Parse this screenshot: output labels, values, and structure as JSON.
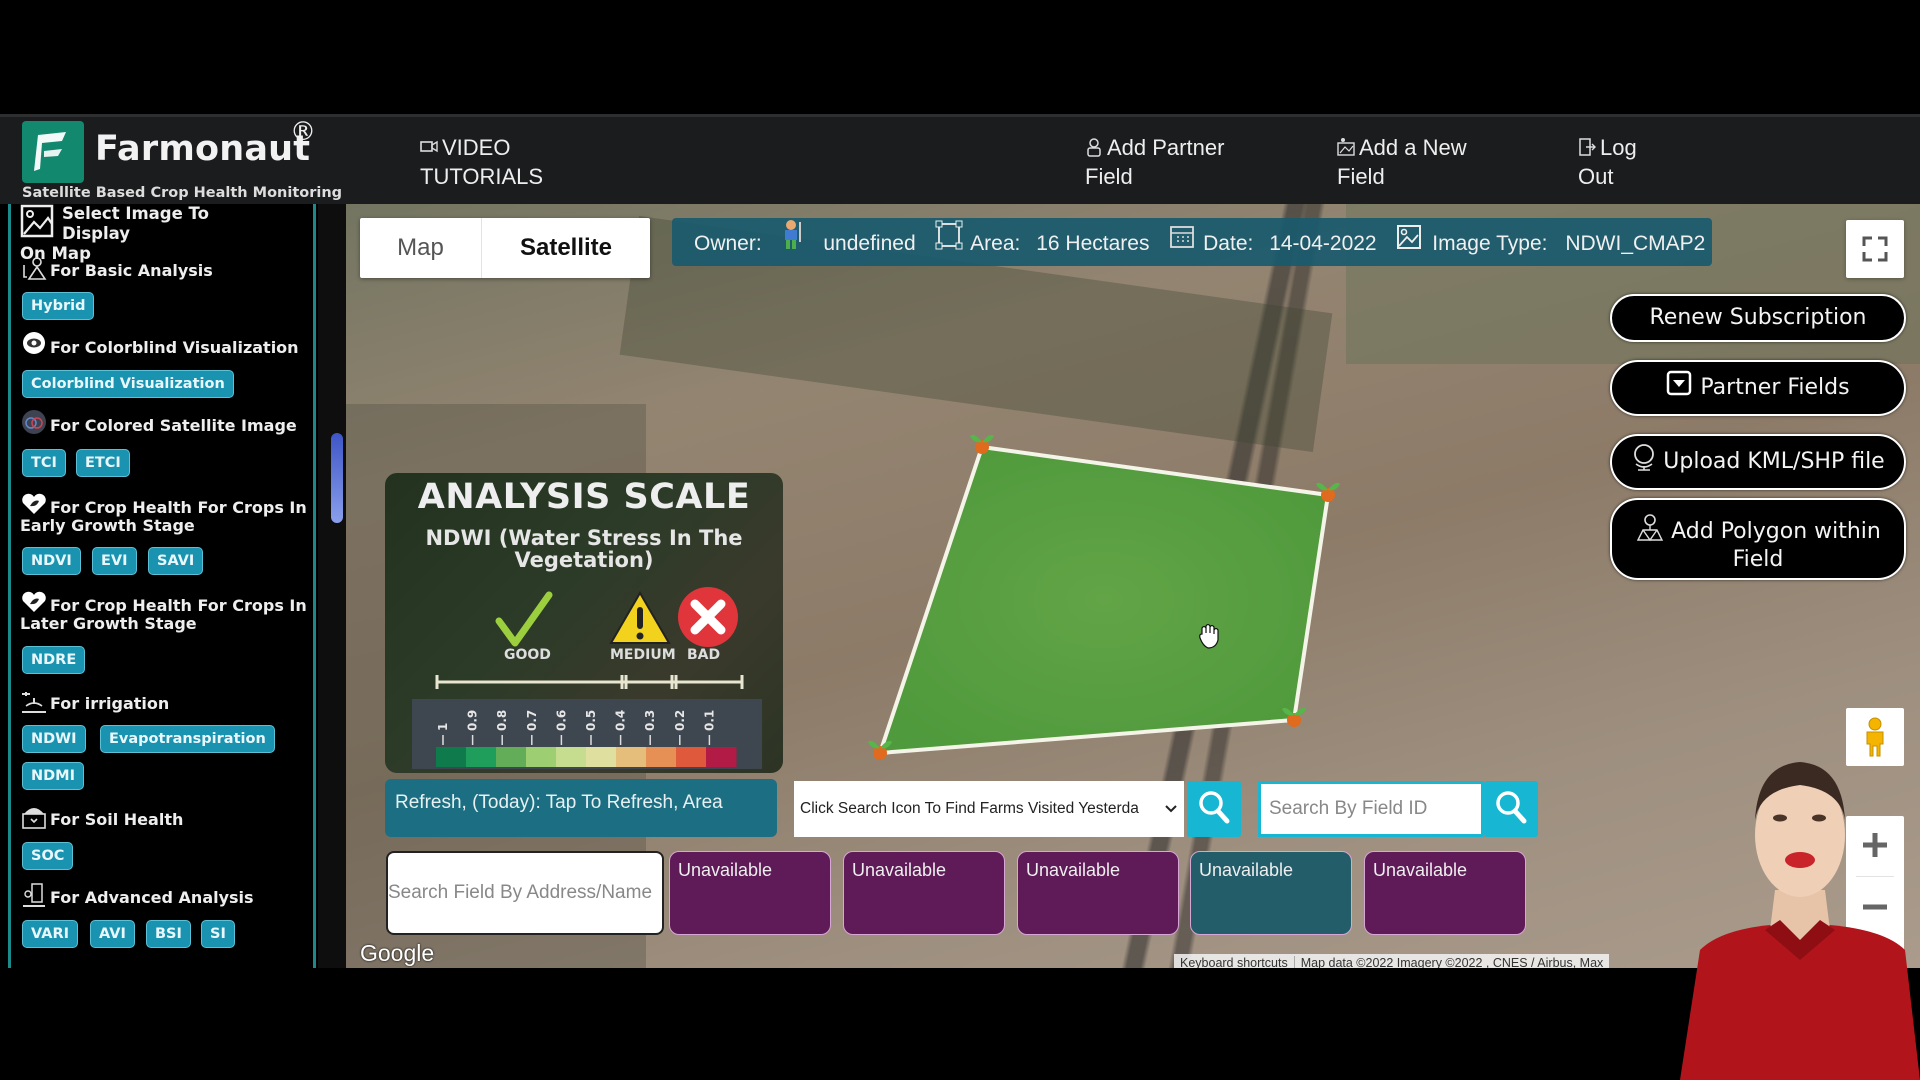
{
  "header": {
    "brand": "Farmonaut",
    "registered_mark": "®",
    "tagline": "Satellite Based Crop Health Monitoring",
    "nav": [
      {
        "icon": "video-camera-icon",
        "line1": "VIDEO",
        "line2": "TUTORIALS"
      },
      {
        "icon": "user-icon",
        "line1": "Add Partner",
        "line2": "Field"
      },
      {
        "icon": "field-icon",
        "line1": "Add a New",
        "line2": "Field"
      },
      {
        "icon": "logout-icon",
        "line1": "Log",
        "line2": "Out"
      }
    ]
  },
  "sidebar": {
    "title_line1": "Select Image To Display",
    "title_line2": "On Map",
    "sections": [
      {
        "label": "For Basic Analysis",
        "icon": "analysis-icon",
        "chips": [
          "Hybrid"
        ]
      },
      {
        "label": "For Colorblind Visualization",
        "icon": "eye-icon",
        "chips": [
          "Colorblind Visualization"
        ]
      },
      {
        "label": "For Colored Satellite Image",
        "icon": "color-rings-icon",
        "chips": [
          "TCI",
          "ETCI"
        ]
      },
      {
        "label_line1": "For Crop Health For Crops In",
        "label_line2": "Early Growth Stage",
        "icon": "leaf-heart-icon",
        "chips": [
          "NDVI",
          "EVI",
          "SAVI"
        ]
      },
      {
        "label_line1": "For Crop Health For Crops In",
        "label_line2": "Later Growth Stage",
        "icon": "leaf-heart-icon",
        "chips": [
          "NDRE"
        ]
      },
      {
        "label": "For irrigation",
        "icon": "tap-icon",
        "chips": [
          "NDWI",
          "Evapotranspiration",
          "NDMI"
        ]
      },
      {
        "label": "For Soil Health",
        "icon": "soil-box-icon",
        "chips": [
          "SOC"
        ]
      },
      {
        "label": "For Advanced Analysis",
        "icon": "microscope-icon",
        "chips": [
          "VARI",
          "AVI",
          "BSI",
          "SI"
        ]
      }
    ]
  },
  "map": {
    "map_type": {
      "map": "Map",
      "satellite": "Satellite",
      "selected": "Satellite"
    },
    "info": {
      "owner_label": "Owner:",
      "owner_value": "undefined",
      "area_label": "Area:",
      "area_value": "16 Hectares",
      "date_label": "Date:",
      "date_value": "14-04-2022",
      "image_type_label": "Image Type:",
      "image_type_value": "NDWI_CMAP2"
    },
    "actions": {
      "renew": "Renew Subscription",
      "partner_fields": "Partner Fields",
      "upload": "Upload KML/SHP file",
      "add_polygon_line1": "Add Polygon within",
      "add_polygon_line2": "Field"
    },
    "scale": {
      "title": "ANALYSIS SCALE",
      "subtitle_line1": "NDWI (Water Stress In The",
      "subtitle_line2": "Vegetation)",
      "good": "GOOD",
      "medium": "MEDIUM",
      "bad": "BAD",
      "ticks": [
        "1",
        "0.9",
        "0.8",
        "0.7",
        "0.6",
        "0.5",
        "0.4",
        "0.3",
        "0.2",
        "0.1"
      ],
      "colors": [
        "#0f7a4c",
        "#1e9d5b",
        "#63ac58",
        "#9dcf72",
        "#c6dd8f",
        "#dfe0a0",
        "#e5be7c",
        "#e69055",
        "#df5a3c",
        "#b21b45"
      ]
    },
    "refresh_label": "Refresh, (Today): Tap To Refresh, Area",
    "farms_select_value": "Click Search Icon To Find Farms Visited Yesterda",
    "field_id_placeholder": "Search By Field ID",
    "address_placeholder": "Search Field By Address/Name",
    "cards": [
      {
        "label": "Unavailable",
        "color": "#5f1a58"
      },
      {
        "label": "Unavailable",
        "color": "#5f1a58"
      },
      {
        "label": "Unavailable",
        "color": "#5f1a58"
      },
      {
        "label": "Unavailable",
        "color": "#245d6a"
      },
      {
        "label": "Unavailable",
        "color": "#5f1a58"
      }
    ],
    "google_logo": "Google",
    "keyboard_shortcuts": "Keyboard shortcuts",
    "map_data": "Map data ©2022 Imagery ©2022 , CNES / Airbus, Max"
  },
  "colors": {
    "brand_green": "#12896f",
    "chip_blue": "#1a93b0",
    "infobar": "#1c5f6f",
    "search_button": "#17b6d2"
  }
}
